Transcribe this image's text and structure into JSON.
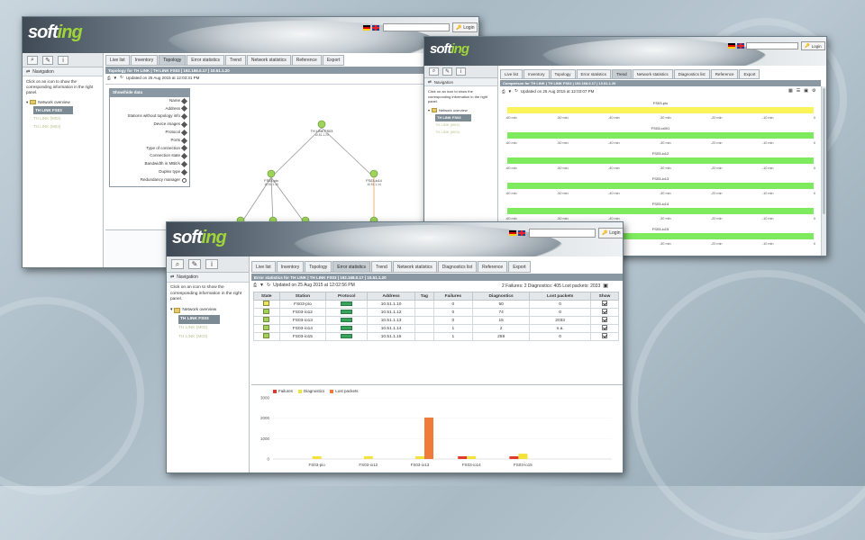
{
  "logo": {
    "a": "soft",
    "b": "ing"
  },
  "login_label": "Login",
  "nav": {
    "title": "Navigation",
    "hint": "Click on an icon to show the corresponding information in the right panel.",
    "overview": "Network overview",
    "devices": [
      "TH LINK FS03",
      "TH LINK (M02)",
      "TH LINK (M03)"
    ]
  },
  "tabs": [
    "Live list",
    "Inventory",
    "Topology",
    "Error statistics",
    "Trend",
    "Network statistics",
    "Diagnostics list",
    "Reference",
    "Export"
  ],
  "w1": {
    "bar": "Topology for TH LINK | TH LINK FS03 | 192.168.0.17 | 10.51.1.20",
    "updated": "Updated on 25 Aug 2015 at 12:03:31 PM",
    "cfg_title": "Show/hide data",
    "cfg_rows": [
      "Name",
      "Address",
      "Stations without topology info",
      "Device images",
      "Protocol",
      "Ports",
      "Type of connection",
      "Connection state",
      "Bandwidth in MBit/s",
      "Duplex type",
      "Redundancy manager"
    ],
    "nodes": [
      {
        "label": "TH LINK FS03",
        "sub": "10.51.1.20"
      },
      {
        "label": "FS03-pio",
        "sub": "10.51.1.10"
      },
      {
        "label": "FS03-io14",
        "sub": "10.51.1.14"
      },
      {
        "label": "FS03-io15",
        "sub": "10.51.1.15"
      },
      {
        "label": "FS03-io12",
        "sub": "10.51.1.12"
      },
      {
        "label": "Router-M02",
        "sub": "10.51.1.13"
      },
      {
        "label": "FS03-io16",
        "sub": "10.51.1.16"
      }
    ]
  },
  "w2": {
    "updated": "Updated on 25 Aug 2015 at 12:03:07 PM",
    "bar": "Comparison for TH LINK | TH LINK FS03 | 192.168.0.17 | 10.51.1.20",
    "ticks": [
      "-60 min",
      "-50 min",
      "-40 min",
      "-30 min",
      "-20 min",
      "-10 min",
      "0"
    ],
    "rows": [
      {
        "label": "FS03-pio",
        "color": "#fbf35a"
      },
      {
        "label": "FS03-io001",
        "color": "#7eea5e"
      },
      {
        "label": "FS03-io12",
        "color": "#7eea5e"
      },
      {
        "label": "FS03-io13",
        "color": "#7eea5e"
      },
      {
        "label": "FS03-io14",
        "color": "#7eea5e"
      },
      {
        "label": "FS03-io15",
        "color": "#7eea5e"
      }
    ]
  },
  "w3": {
    "bar": "Error statistics for TH LINK | TH LINK FS03 | 192.168.0.17 | 10.51.1.20",
    "updated": "Updated on 25 Aug 2015 at 12:02:56 PM",
    "summary": "2 Failures: 2 Diagnostics: 405 Lost packets: 2033",
    "columns": [
      "State",
      "Station",
      "Protocol",
      "Address",
      "Tag",
      "Failures",
      "Diagnostics",
      "Lost packets",
      "Show"
    ],
    "rows": [
      {
        "state": "warn",
        "station": "FS03-pio",
        "address": "10.51.1.10",
        "tag": "",
        "failures": "0",
        "diagnostics": "50",
        "lost": "0"
      },
      {
        "state": "ok",
        "station": "FS03-io12",
        "address": "10.51.1.12",
        "tag": "",
        "failures": "0",
        "diagnostics": "74",
        "lost": "0"
      },
      {
        "state": "ok",
        "station": "FS03-io13",
        "address": "10.51.1.13",
        "tag": "",
        "failures": "0",
        "diagnostics": "15",
        "lost": "2033"
      },
      {
        "state": "ok",
        "station": "FS03-io14",
        "address": "10.51.1.14",
        "tag": "",
        "failures": "1",
        "diagnostics": "2",
        "lost": "n.a."
      },
      {
        "state": "ok",
        "station": "FS03-io15",
        "address": "10.51.1.15",
        "tag": "",
        "failures": "1",
        "diagnostics": "259",
        "lost": "0"
      }
    ],
    "legend": [
      {
        "name": "Failures",
        "color": "#e23a2a"
      },
      {
        "name": "Diagnostics",
        "color": "#f2e33a"
      },
      {
        "name": "Lost packets",
        "color": "#f07a3a"
      }
    ]
  },
  "chart_data": {
    "type": "bar",
    "categories": [
      "FS03-pio",
      "FS03-io12",
      "FS03-io13",
      "FS03-io14",
      "FS03-io15"
    ],
    "series": [
      {
        "name": "Failures",
        "values": [
          0,
          0,
          0,
          1,
          1
        ]
      },
      {
        "name": "Diagnostics",
        "values": [
          50,
          74,
          15,
          2,
          259
        ]
      },
      {
        "name": "Lost packets",
        "values": [
          0,
          0,
          2033,
          0,
          0
        ]
      }
    ],
    "yticks": [
      "3000",
      "2000",
      "1000",
      "0"
    ],
    "ylim": [
      0,
      3000
    ],
    "legend": "top-left"
  }
}
